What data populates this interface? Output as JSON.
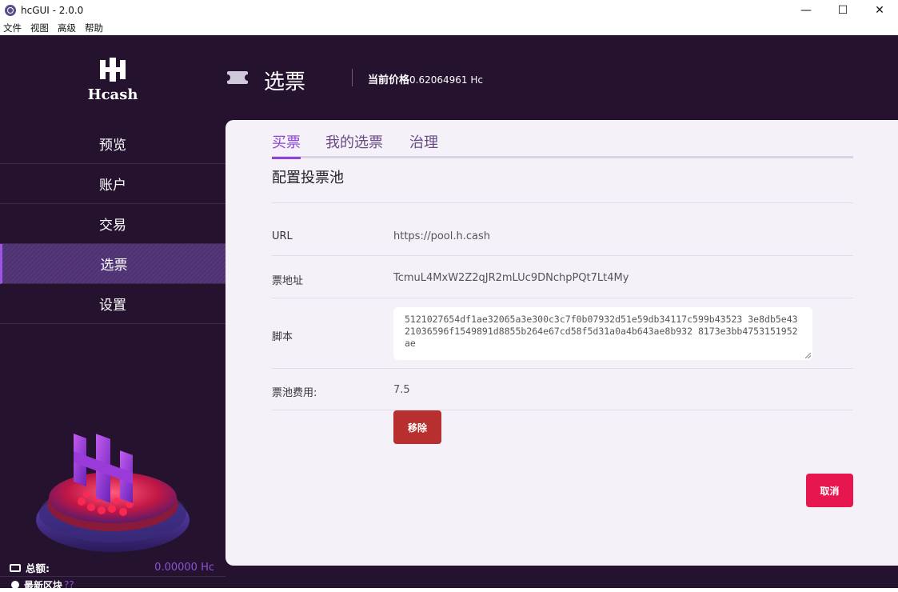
{
  "window": {
    "title": "hcGUI - 2.0.0",
    "minimize": "—",
    "maximize": "☐",
    "close": "✕"
  },
  "menubar": {
    "items": [
      "文件",
      "视图",
      "高级",
      "帮助"
    ]
  },
  "sidebar": {
    "logo_mark": "ⴼ",
    "logo_name": "Hcash",
    "nav": [
      {
        "label": "预览"
      },
      {
        "label": "账户"
      },
      {
        "label": "交易"
      },
      {
        "label": "选票"
      },
      {
        "label": "设置"
      }
    ],
    "balance": {
      "label": "总额:",
      "value": "0.00000 Hc"
    },
    "latest_block": {
      "label": "最新区块",
      "value": "??"
    }
  },
  "header": {
    "title": "选票",
    "price_label": "当前价格",
    "price_value": "0.62064961 Hc"
  },
  "tabs": [
    {
      "label": "买票"
    },
    {
      "label": "我的选票"
    },
    {
      "label": "治理"
    }
  ],
  "section": {
    "title": "配置投票池"
  },
  "fields": {
    "url": {
      "label": "URL",
      "value": "https://pool.h.cash"
    },
    "ticket_address": {
      "label": "票地址",
      "value": "TcmuL4MxW2Z2qJR2mLUc9DNchpPQt7Lt4My"
    },
    "script": {
      "label": "脚本",
      "value": "5121027654df1ae32065a3e300c3c7f0b07932d51e59db34117c599b43523 3e8db5e4321036596f1549891d8855b264e67cd58f5d31a0a4b643ae8b932 8173e3bb4753151952ae"
    },
    "pool_fee": {
      "label": "票池费用:",
      "value": "7.5"
    }
  },
  "buttons": {
    "remove": "移除",
    "cancel": "取消"
  },
  "colors": {
    "sidebar_bg": "#24122f",
    "accent": "#8e44d6",
    "remove": "#b7302f",
    "cancel": "#e8164e"
  }
}
